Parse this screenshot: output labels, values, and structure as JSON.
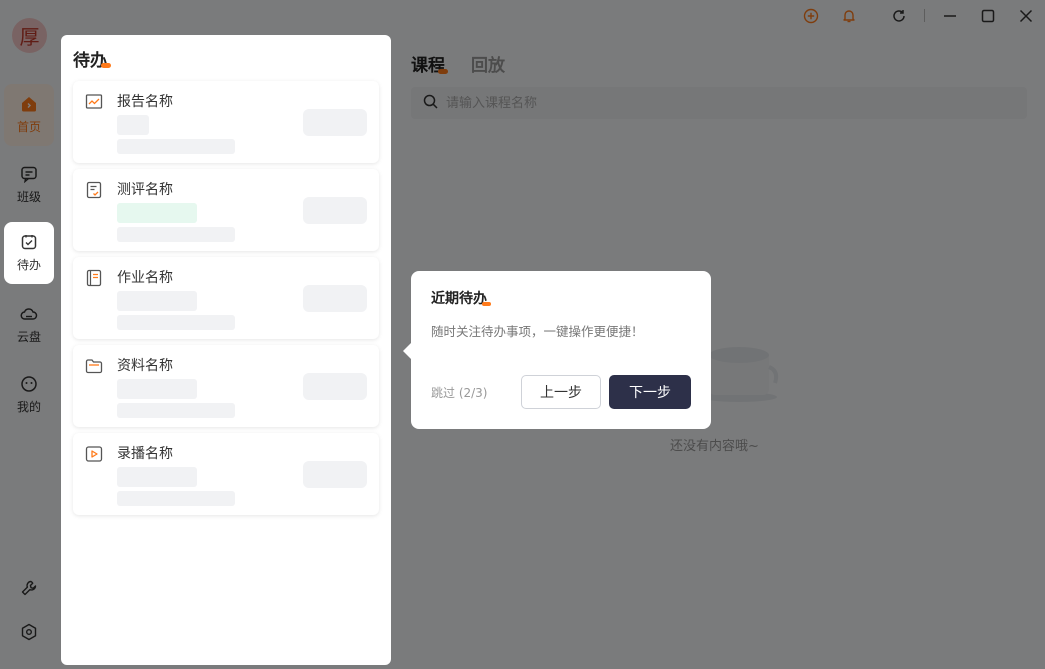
{
  "sidebar": {
    "avatar_char": "厚",
    "nav": [
      {
        "label": "首页",
        "icon": "home-icon",
        "active": true
      },
      {
        "label": "班级",
        "icon": "chat-icon"
      },
      {
        "label": "待办",
        "icon": "checklist-icon",
        "highlight": true
      },
      {
        "label": "云盘",
        "icon": "cloud-icon"
      },
      {
        "label": "我的",
        "icon": "face-icon"
      }
    ],
    "bottom": [
      "wrench-icon",
      "settings-icon"
    ]
  },
  "titlebar": {
    "icons": [
      "add-circle-icon",
      "bell-icon",
      "refresh-icon",
      "minimize-icon",
      "maximize-icon",
      "close-icon"
    ],
    "accent": "#ff7a1a"
  },
  "main": {
    "tabs": [
      {
        "label": "课程",
        "active": true
      },
      {
        "label": "回放"
      }
    ],
    "search_placeholder": "请输入课程名称",
    "empty_text": "还没有内容哦~"
  },
  "todo": {
    "title": "待办",
    "items": [
      {
        "name": "报告名称",
        "icon": "report-icon"
      },
      {
        "name": "测评名称",
        "icon": "assessment-icon"
      },
      {
        "name": "作业名称",
        "icon": "homework-icon"
      },
      {
        "name": "资料名称",
        "icon": "folder-icon"
      },
      {
        "name": "录播名称",
        "icon": "video-icon"
      }
    ]
  },
  "tooltip": {
    "title": "近期待办",
    "desc": "随时关注待办事项，一键操作更便捷！",
    "skip": "跳过 (2/3)",
    "prev": "上一步",
    "next": "下一步"
  }
}
